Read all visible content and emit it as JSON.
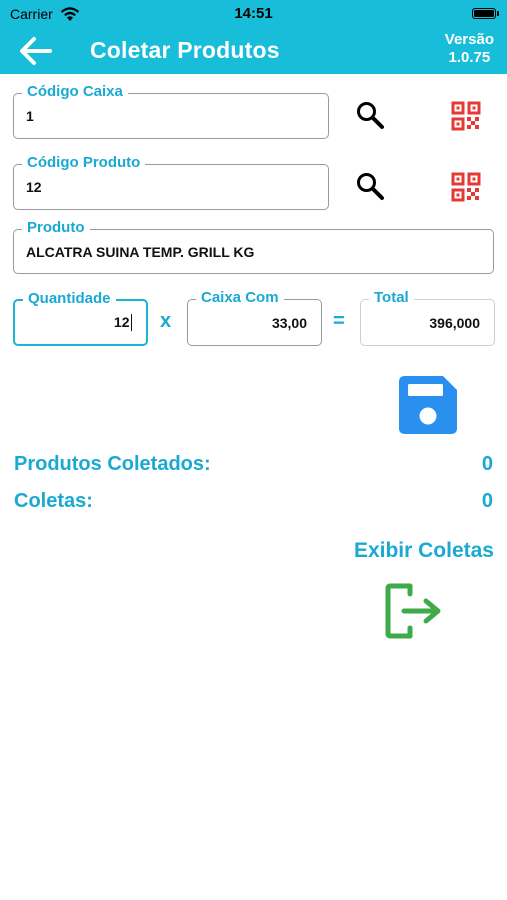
{
  "status_bar": {
    "carrier": "Carrier",
    "time": "14:51"
  },
  "header": {
    "title": "Coletar Produtos",
    "version_label": "Versão",
    "version_number": "1.0.75"
  },
  "form": {
    "codigo_caixa": {
      "label": "Código Caixa",
      "value": "1"
    },
    "codigo_produto": {
      "label": "Código Produto",
      "value": "12"
    },
    "produto": {
      "label": "Produto",
      "value": "ALCATRA SUINA TEMP. GRILL KG"
    },
    "quantidade": {
      "label": "Quantidade",
      "value": "12"
    },
    "multiply_symbol": "x",
    "caixa_com": {
      "label": "Caixa Com",
      "value": "33,00"
    },
    "equals_symbol": "=",
    "total": {
      "label": "Total",
      "value": "396,000"
    }
  },
  "summary": {
    "produtos_coletados_label": "Produtos Coletados:",
    "produtos_coletados_value": "0",
    "coletas_label": "Coletas:",
    "coletas_value": "0"
  },
  "actions": {
    "exibir_coletas": "Exibir Coletas"
  },
  "icons": {
    "back": "arrow-left-icon",
    "search": "search-icon",
    "qr": "qr-code-icon",
    "save": "floppy-disk-icon",
    "exit": "exit-arrow-icon",
    "wifi": "wifi-icon",
    "battery": "battery-icon"
  },
  "colors": {
    "header": "#18bdd9",
    "accent": "#1aa9d3",
    "save": "#2a90f0",
    "qr": "#e53935",
    "exit": "#3eaa4a"
  }
}
